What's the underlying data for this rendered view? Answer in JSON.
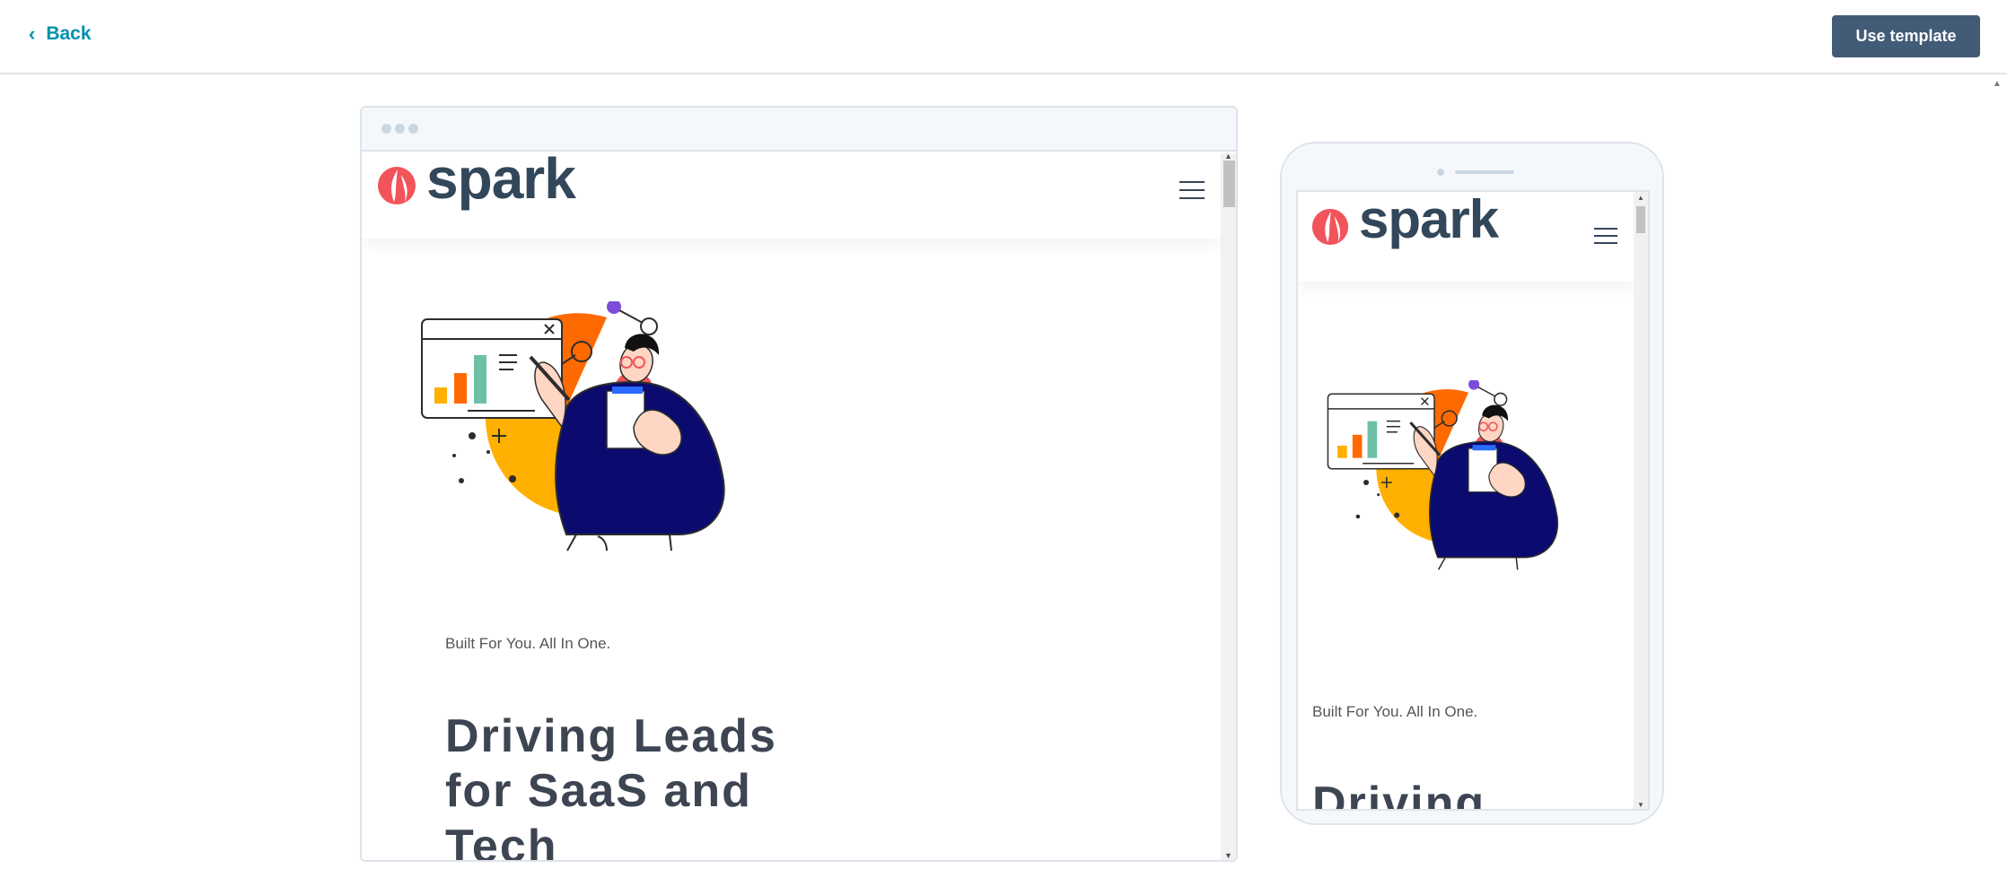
{
  "toolbar": {
    "back_label": "Back",
    "use_template_label": "Use template"
  },
  "brand": {
    "name": "spark",
    "accent": "#f2545b",
    "dark": "#33475b"
  },
  "hero": {
    "tagline": "Built For You. All In One.",
    "title_desktop_lines": [
      "Driving Leads",
      "for SaaS and",
      "Tech"
    ],
    "title_mobile": "Driving"
  },
  "icons": {
    "back": "chevron-left-icon",
    "menu": "hamburger-menu-icon"
  }
}
